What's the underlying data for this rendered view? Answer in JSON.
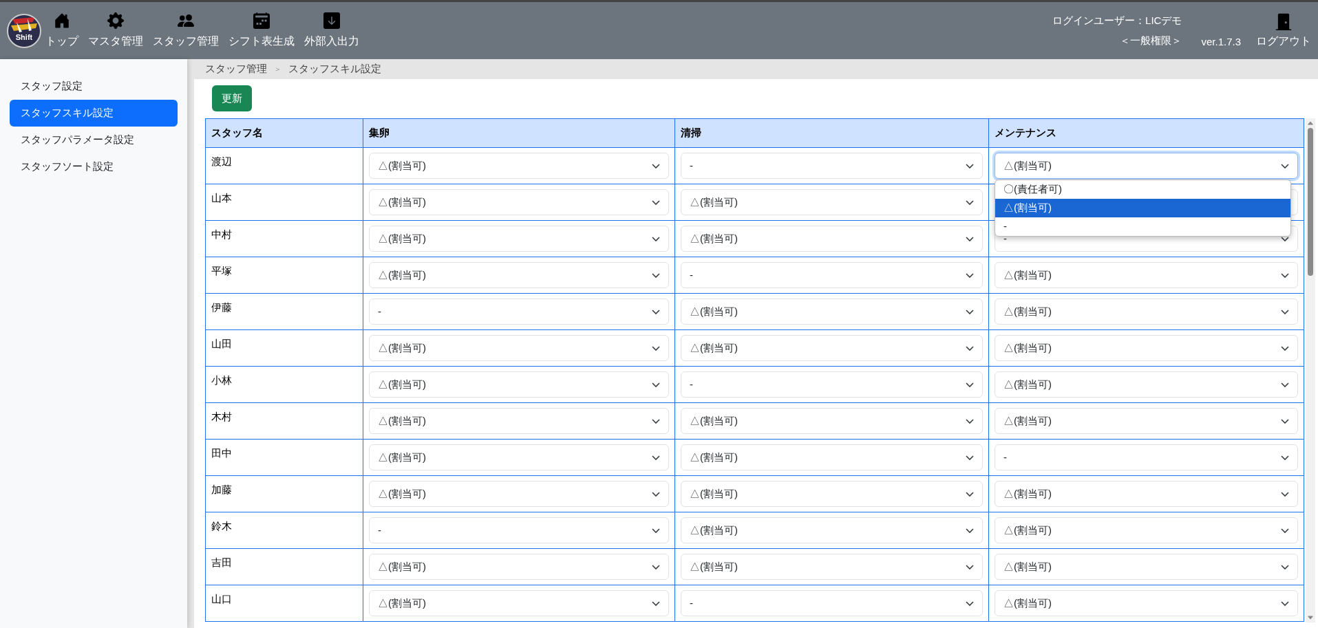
{
  "header": {
    "logo": {
      "text": "Shift"
    },
    "nav": [
      {
        "label": "トップ"
      },
      {
        "label": "マスタ管理"
      },
      {
        "label": "スタッフ管理"
      },
      {
        "label": "シフト表生成"
      },
      {
        "label": "外部入出力"
      }
    ],
    "user": "ログインユーザー：LICデモ",
    "role": "＜一般権限＞",
    "version": "ver.1.7.3",
    "logout": "ログアウト"
  },
  "sidebar": {
    "items": [
      {
        "label": "スタッフ設定",
        "selected": false
      },
      {
        "label": "スタッフスキル設定",
        "selected": true
      },
      {
        "label": "スタッフパラメータ設定",
        "selected": false
      },
      {
        "label": "スタッフソート設定",
        "selected": false
      }
    ]
  },
  "breadcrumb": [
    "スタッフ管理",
    "＞",
    "スタッフスキル設定"
  ],
  "update_button": "更新",
  "table": {
    "columns": [
      "スタッフ名",
      "集卵",
      "清掃",
      "メンテナンス"
    ],
    "rows": [
      {
        "cells": [
          {
            "value": "渡辺"
          },
          {
            "value": "△(割当可)"
          },
          {
            "value": "-"
          },
          {
            "value": "△(割当可)",
            "open": true,
            "options": [
              {
                "label": "〇(責任者可)",
                "selected": false
              },
              {
                "label": "△(割当可)",
                "selected": true
              },
              {
                "label": "-",
                "selected": false
              }
            ]
          }
        ]
      },
      {
        "cells": [
          {
            "value": "山本"
          },
          {
            "value": "△(割当可)"
          },
          {
            "value": "△(割当可)"
          },
          {}
        ]
      },
      {
        "cells": [
          {
            "value": "中村"
          },
          {
            "value": "△(割当可)"
          },
          {
            "value": "△(割当可)"
          },
          {
            "value": "-"
          }
        ]
      },
      {
        "cells": [
          {
            "value": "平塚"
          },
          {
            "value": "△(割当可)"
          },
          {
            "value": "-"
          },
          {
            "value": "△(割当可)"
          }
        ]
      },
      {
        "cells": [
          {
            "value": "伊藤"
          },
          {
            "value": "-"
          },
          {
            "value": "△(割当可)"
          },
          {
            "value": "△(割当可)"
          }
        ]
      },
      {
        "cells": [
          {
            "value": "山田"
          },
          {
            "value": "△(割当可)"
          },
          {
            "value": "△(割当可)"
          },
          {
            "value": "△(割当可)"
          }
        ]
      },
      {
        "cells": [
          {
            "value": "小林"
          },
          {
            "value": "△(割当可)"
          },
          {
            "value": "-"
          },
          {
            "value": "△(割当可)"
          }
        ]
      },
      {
        "cells": [
          {
            "value": "木村"
          },
          {
            "value": "△(割当可)"
          },
          {
            "value": "△(割当可)"
          },
          {
            "value": "△(割当可)"
          }
        ]
      },
      {
        "cells": [
          {
            "value": "田中"
          },
          {
            "value": "△(割当可)"
          },
          {
            "value": "△(割当可)"
          },
          {
            "value": "-"
          }
        ]
      },
      {
        "cells": [
          {
            "value": "加藤"
          },
          {
            "value": "△(割当可)"
          },
          {
            "value": "△(割当可)"
          },
          {
            "value": "△(割当可)"
          }
        ]
      },
      {
        "cells": [
          {
            "value": "鈴木"
          },
          {
            "value": "-"
          },
          {
            "value": "△(割当可)"
          },
          {
            "value": "△(割当可)"
          }
        ]
      },
      {
        "cells": [
          {
            "value": "吉田"
          },
          {
            "value": "△(割当可)"
          },
          {
            "value": "△(割当可)"
          },
          {
            "value": "△(割当可)"
          }
        ]
      },
      {
        "cells": [
          {
            "value": "山口"
          },
          {
            "value": "△(割当可)"
          },
          {
            "value": "-"
          },
          {
            "value": "△(割当可)"
          }
        ]
      }
    ]
  }
}
